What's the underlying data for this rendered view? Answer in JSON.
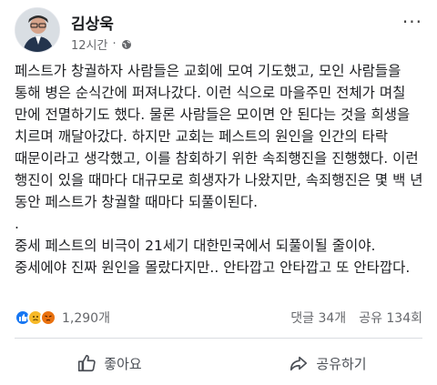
{
  "post": {
    "author": "김상욱",
    "time": "12시간",
    "more_label": "···",
    "paragraph_1": "페스트가 창궐하자 사람들은 교회에 모여 기도했고, 모인 사람들을 통해 병은 순식간에 퍼져나갔다. 이런 식으로 마을주민 전체가 며칠 만에 전멸하기도 했다. 물론 사람들은 모이면 안 된다는 것을 희생을 치르며 깨달아갔다. 하지만 교회는 페스트의 원인을 인간의 타락 때문이라고 생각했고, 이를 참회하기 위한 속죄행진을 진행했다. 이런 행진이 있을 때마다 대규모로 희생자가 나왔지만, 속죄행진은 몇 백 년 동안 페스트가 창궐할 때마다 되풀이된다.",
    "separator": ".",
    "paragraph_2": "중세 페스트의 비극이 21세기 대한민국에서 되풀이될 줄이야. 중세에야 진짜 원인을 몰랐다지만.. 안타깝고 안타깝고 또 안타깝다."
  },
  "stats": {
    "reaction_count": "1,290개",
    "comments": "댓글 34개",
    "shares": "공유 134회"
  },
  "actions": {
    "like_label": "좋아요",
    "share_label": "공유하기"
  },
  "icons": {
    "globe": "globe-icon",
    "like": "thumbs-up-icon",
    "share": "share-arrow-icon"
  },
  "colors": {
    "accent": "#1877f2",
    "text": "#1c1e21",
    "muted": "#65676b"
  }
}
